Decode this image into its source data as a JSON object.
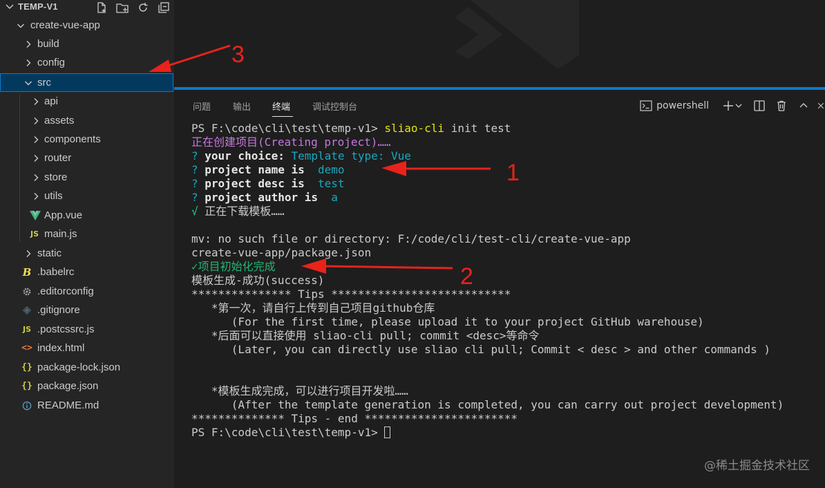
{
  "explorer": {
    "title": "TEMP-V1",
    "items": [
      {
        "label": "create-vue-app",
        "icon": "chevron-down-icon"
      },
      {
        "label": "build",
        "icon": "chevron-right-icon"
      },
      {
        "label": "config",
        "icon": "chevron-right-icon"
      },
      {
        "label": "src",
        "icon": "chevron-down-icon"
      },
      {
        "label": "api",
        "icon": "chevron-right-icon"
      },
      {
        "label": "assets",
        "icon": "chevron-right-icon"
      },
      {
        "label": "components",
        "icon": "chevron-right-icon"
      },
      {
        "label": "router",
        "icon": "chevron-right-icon"
      },
      {
        "label": "store",
        "icon": "chevron-right-icon"
      },
      {
        "label": "utils",
        "icon": "chevron-right-icon"
      },
      {
        "label": "App.vue",
        "icon": "vue-file-icon"
      },
      {
        "label": "main.js",
        "icon": "js-file-icon"
      },
      {
        "label": "static",
        "icon": "chevron-right-icon"
      },
      {
        "label": ".babelrc",
        "icon": "babel-file-icon"
      },
      {
        "label": ".editorconfig",
        "icon": "gear-file-icon"
      },
      {
        "label": ".gitignore",
        "icon": "git-file-icon"
      },
      {
        "label": ".postcssrc.js",
        "icon": "js-file-icon"
      },
      {
        "label": "index.html",
        "icon": "html-file-icon"
      },
      {
        "label": "package-lock.json",
        "icon": "json-file-icon"
      },
      {
        "label": "package.json",
        "icon": "json-file-icon"
      },
      {
        "label": "README.md",
        "icon": "info-file-icon"
      }
    ]
  },
  "panel": {
    "tabs": [
      "问题",
      "输出",
      "终端",
      "调试控制台"
    ],
    "active_tab": "终端",
    "shell": "powershell"
  },
  "terminal": {
    "l1_prompt": "PS F:\\code\\cli\\test\\temp-v1> ",
    "l1_cmd": "sliao-cli",
    "l1_args": " init test",
    "l2": "正在创建项目(Creating project)……",
    "l3_q": "? ",
    "l3_label": "your choice: ",
    "l3_value": "Template type: Vue",
    "l4_q": "? ",
    "l4_label": "project name is ",
    "l4_value": " demo",
    "l5_q": "? ",
    "l5_label": "project desc is ",
    "l5_value": " test",
    "l6_q": "? ",
    "l6_label": "project author is ",
    "l6_value": " a",
    "l7_mark": "√ ",
    "l7_text": "正在下载模板……",
    "l9": "mv: no such file or directory: F:/code/cli/test-cli/create-vue-app",
    "l10": "create-vue-app/package.json",
    "l11": "✓项目初始化完成",
    "l12": "模板生成-成功(success)",
    "l13": "*************** Tips ***************************",
    "l14": "   *第一次，请自行上传到自己项目github仓库",
    "l15": "      (For the first time, please upload it to your project GitHub warehouse)",
    "l16": "   *后面可以直接使用 sliao-cli pull; commit <desc>等命令",
    "l17": "      (Later, you can directly use sliao cli pull; Commit < desc > and other commands )",
    "l20": "   *模板生成完成，可以进行项目开发啦……",
    "l21": "      (After the template generation is completed, you can carry out project development)",
    "l22": "************** Tips - end ***********************",
    "l23_prompt": "PS F:\\code\\cli\\test\\temp-v1> "
  },
  "annotations": {
    "n1": "1",
    "n2": "2",
    "n3": "3"
  },
  "watermark": "@稀土掘金技术社区",
  "colors": {
    "accent": "#0a7acc",
    "arrow": "#e8231b",
    "selected_bg": "#04395e"
  }
}
